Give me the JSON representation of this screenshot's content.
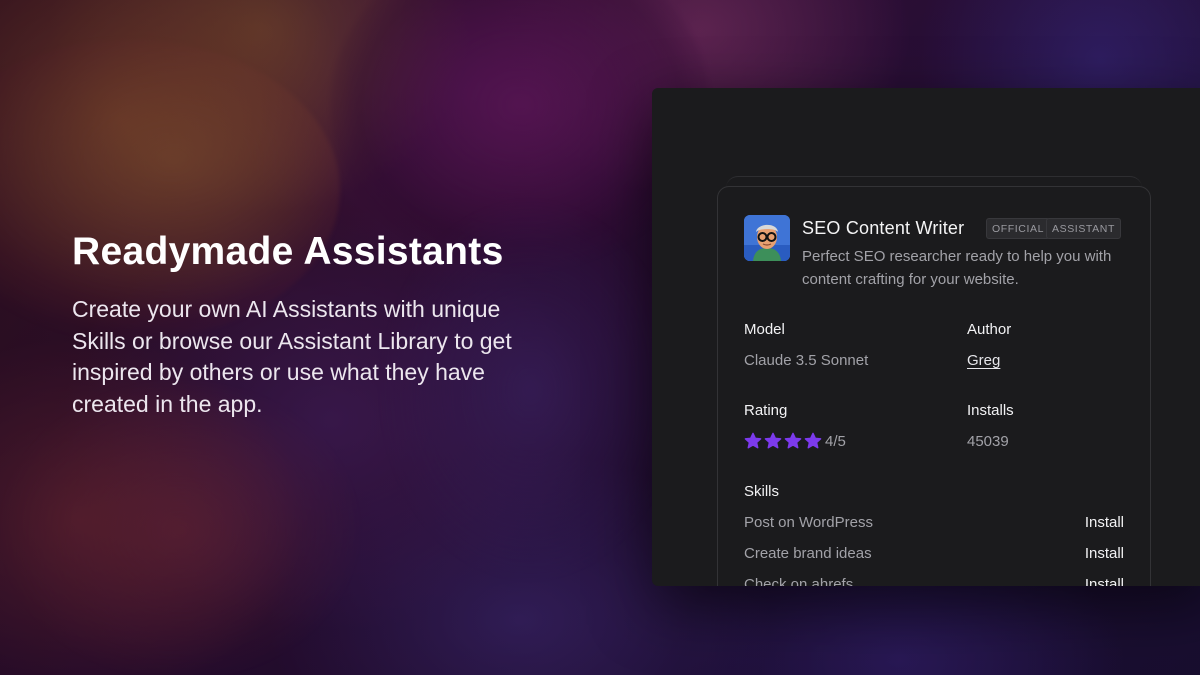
{
  "hero": {
    "title": "Readymade Assistants",
    "description": "Create your own AI Assistants with unique Skills or browse our Assistant Library to get inspired by others or use what they have created in the app."
  },
  "assistant": {
    "name": "SEO Content Writer",
    "badges": [
      "OFFICIAL",
      "ASSISTANT"
    ],
    "description": "Perfect SEO researcher ready to help you with content crafting for your website.",
    "model_label": "Model",
    "model_value": "Claude 3.5 Sonnet",
    "author_label": "Author",
    "author_value": "Greg",
    "rating_label": "Rating",
    "rating_value": "4/5",
    "rating_stars": 4,
    "installs_label": "Installs",
    "installs_value": "45039",
    "skills_label": "Skills",
    "skills": [
      {
        "name": "Post on WordPress",
        "action": "Install"
      },
      {
        "name": "Create brand ideas",
        "action": "Install"
      },
      {
        "name": "Check on ahrefs",
        "action": "Install"
      }
    ]
  },
  "colors": {
    "star": "#7c3aed",
    "panel": "#1b1b1d",
    "card_border": "#333336"
  }
}
